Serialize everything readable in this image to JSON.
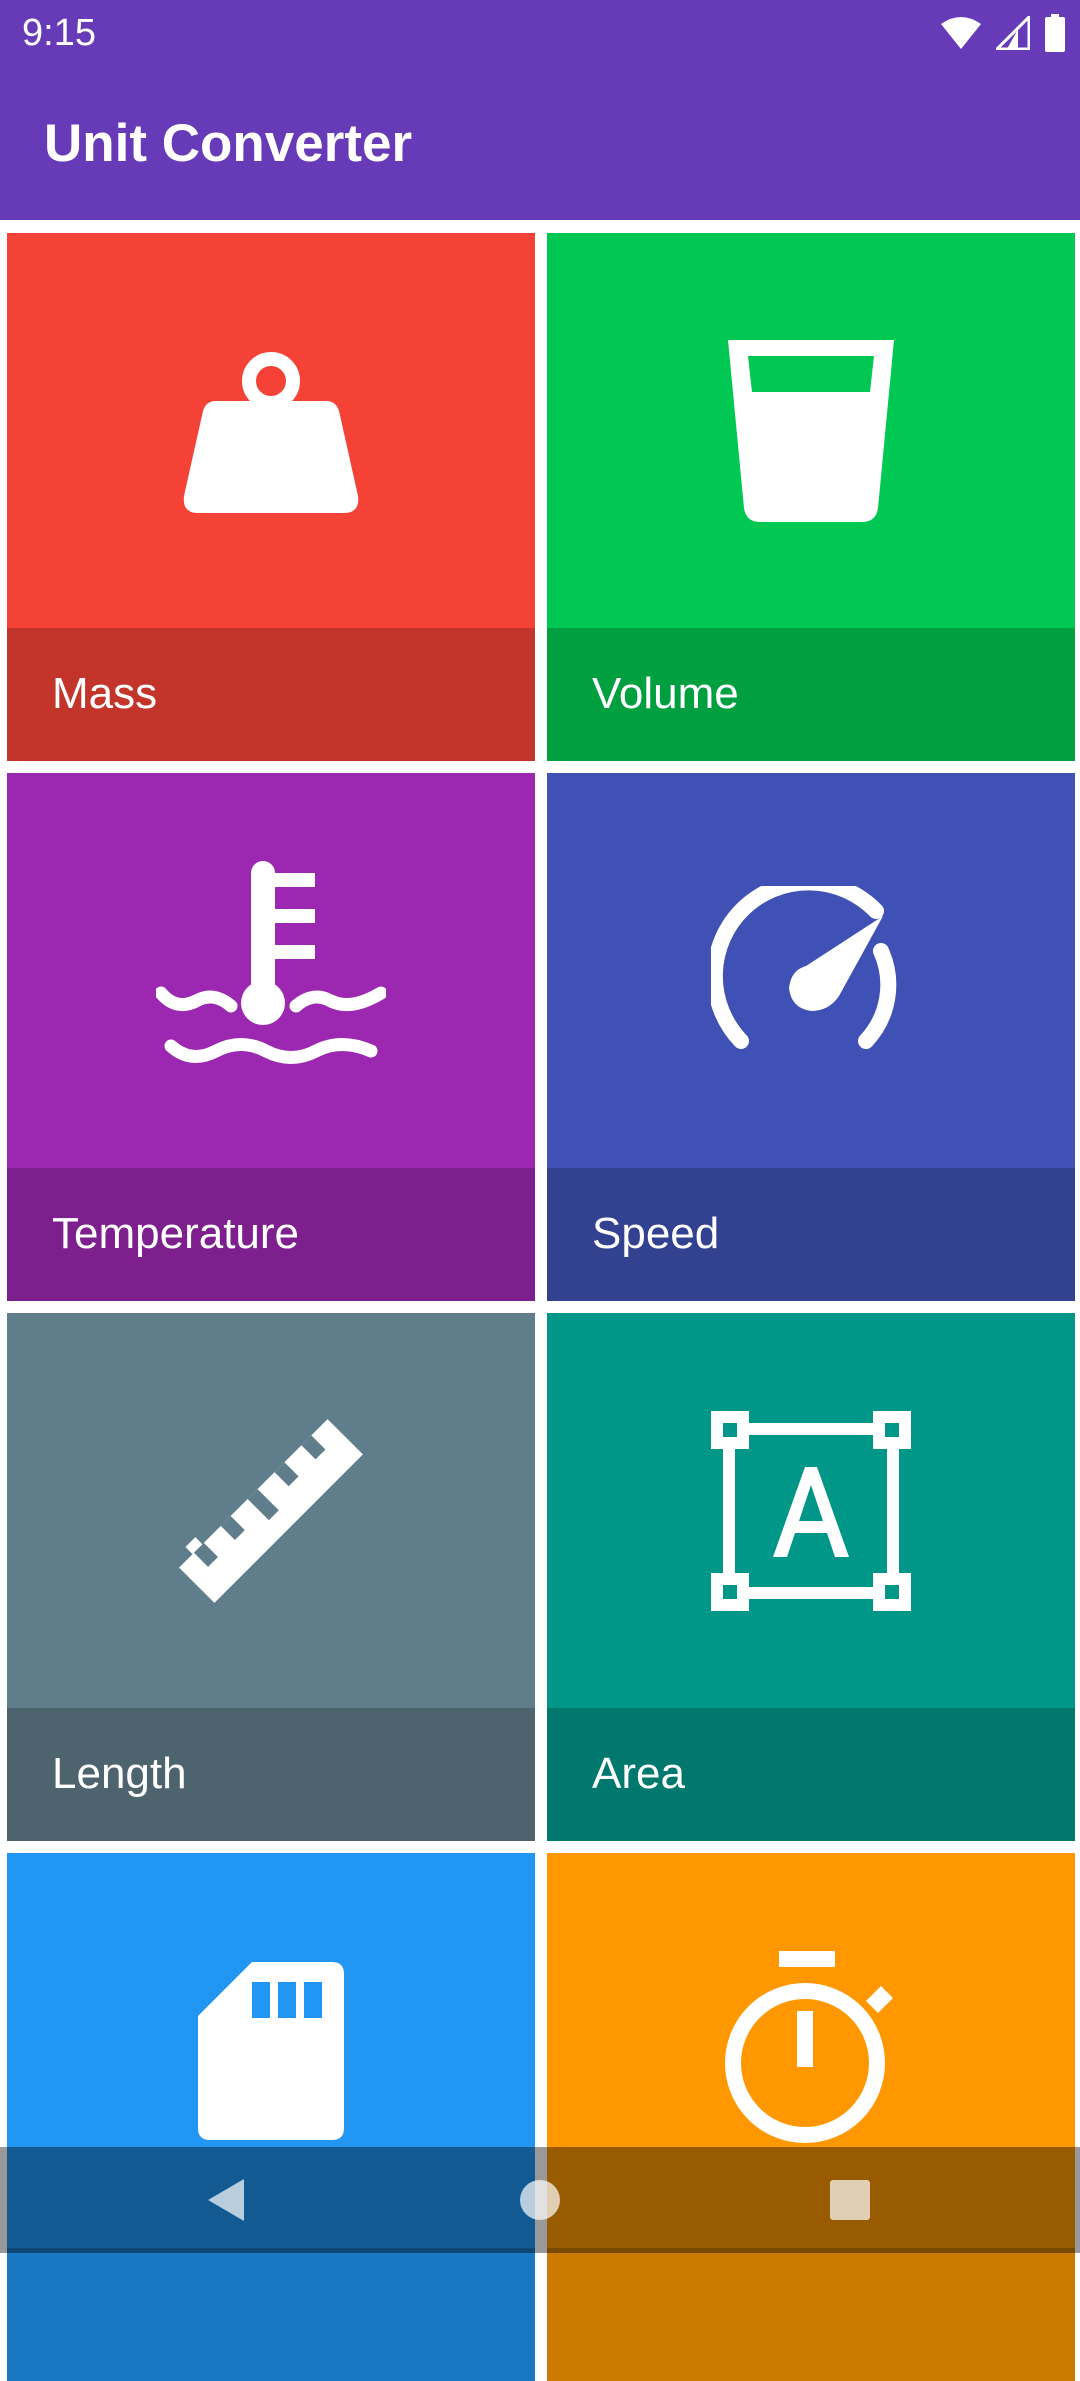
{
  "status_bar": {
    "time": "9:15",
    "icons": [
      "wifi-icon",
      "cell-signal-icon",
      "battery-icon"
    ]
  },
  "app_bar": {
    "title": "Unit Converter"
  },
  "categories": [
    {
      "label": "Mass",
      "icon": "weight-icon",
      "color": "#f44336",
      "dark_color": "#c3352b"
    },
    {
      "label": "Volume",
      "icon": "glass-icon",
      "color": "#00c853",
      "dark_color": "#00a040"
    },
    {
      "label": "Temperature",
      "icon": "thermometer-water-icon",
      "color": "#9c27b0",
      "dark_color": "#7d1f8d"
    },
    {
      "label": "Speed",
      "icon": "speedometer-icon",
      "color": "#3f51b5",
      "dark_color": "#324190"
    },
    {
      "label": "Length",
      "icon": "ruler-icon",
      "color": "#607d8b",
      "dark_color": "#4d646f"
    },
    {
      "label": "Area",
      "icon": "area-text-icon",
      "color": "#009688",
      "dark_color": "#00786d"
    },
    {
      "label": "",
      "icon": "sd-card-icon",
      "color": "#2196f3",
      "dark_color": "#1a78c2"
    },
    {
      "label": "",
      "icon": "stopwatch-icon",
      "color": "#ff9800",
      "dark_color": "#cc7a00"
    }
  ],
  "nav_bar": {
    "back": "back-icon",
    "home": "home-icon",
    "recents": "recents-icon"
  }
}
